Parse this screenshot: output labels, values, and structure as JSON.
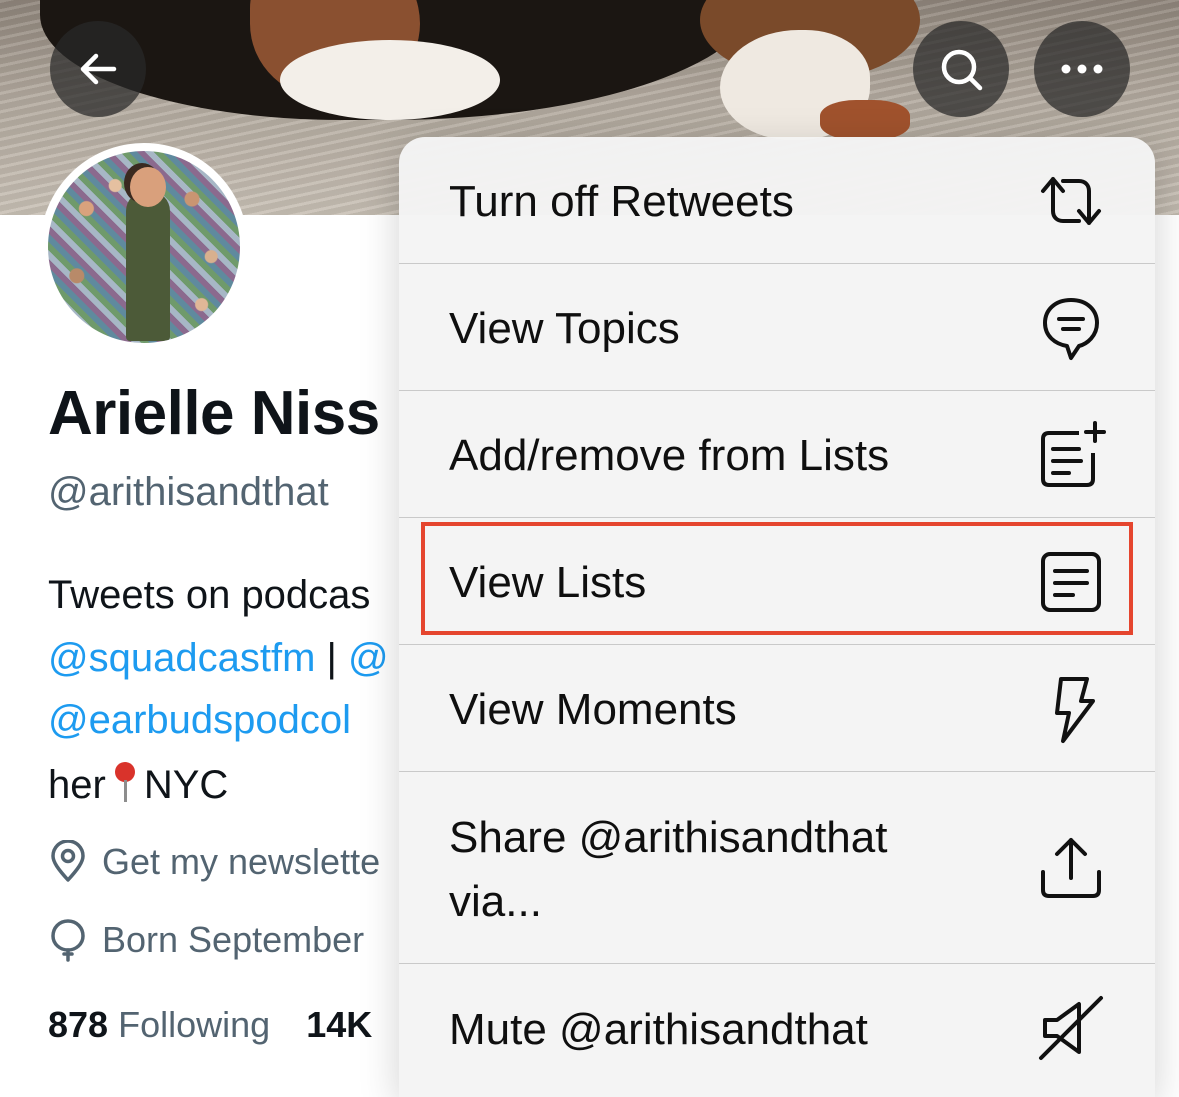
{
  "header": {
    "back_icon": "arrow-left-icon",
    "search_icon": "search-icon",
    "more_icon": "more-horizontal-icon"
  },
  "profile": {
    "name": "Arielle Niss",
    "handle": "@arithisandthat",
    "bio": {
      "line1": "Tweets on podcas",
      "link1": "@squadcastfm",
      "sep": " | ",
      "link2": "@",
      "link3": "@earbudspodcol",
      "line4a": "her",
      "line4b": "NYC"
    },
    "location": "Get my newslette",
    "birthday": "Born September",
    "stats": {
      "following_count": "878",
      "following_label": "Following",
      "followers_count": "14K"
    }
  },
  "menu": {
    "items": [
      {
        "label": "Turn off Retweets",
        "icon": "retweet-icon"
      },
      {
        "label": "View Topics",
        "icon": "topics-icon"
      },
      {
        "label": "Add/remove from Lists",
        "icon": "list-add-icon"
      },
      {
        "label": "View Lists",
        "icon": "lists-icon"
      },
      {
        "label": "View Moments",
        "icon": "lightning-icon"
      },
      {
        "label": "Share @arithisandthat\nvia...",
        "icon": "share-icon"
      },
      {
        "label": "Mute @arithisandthat",
        "icon": "mute-icon"
      }
    ]
  },
  "colors": {
    "link": "#1d9bf0",
    "highlight_border": "#e5452e",
    "secondary_text": "#536471"
  }
}
